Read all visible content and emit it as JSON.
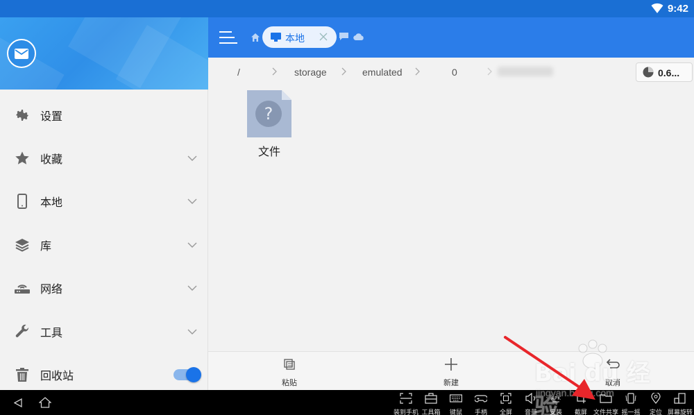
{
  "status_bar": {
    "time": "9:42"
  },
  "drawer": {
    "items": [
      {
        "label": "设置",
        "icon": "gear-icon",
        "expandable": false
      },
      {
        "label": "收藏",
        "icon": "star-icon",
        "expandable": true
      },
      {
        "label": "本地",
        "icon": "phone-icon",
        "expandable": true
      },
      {
        "label": "库",
        "icon": "layers-icon",
        "expandable": true
      },
      {
        "label": "网络",
        "icon": "router-icon",
        "expandable": true
      },
      {
        "label": "工具",
        "icon": "wrench-icon",
        "expandable": true
      },
      {
        "label": "回收站",
        "icon": "trash-icon",
        "toggle": true
      }
    ]
  },
  "toolbar": {
    "active_tab": "本地"
  },
  "path": {
    "crumbs": [
      "/",
      "storage",
      "emulated",
      "0"
    ],
    "storage_usage": "0.6..."
  },
  "files": [
    {
      "name": "文件",
      "icon": "unknown-file-icon"
    }
  ],
  "action_bar": {
    "paste": "粘贴",
    "new": "新建",
    "cancel": "取消"
  },
  "nav_tools": [
    {
      "label": "装到手机",
      "icon": "scan-icon"
    },
    {
      "label": "工具箱",
      "icon": "toolbox-icon"
    },
    {
      "label": "键鼠",
      "icon": "keyboard-icon"
    },
    {
      "label": "手柄",
      "icon": "gamepad-icon"
    },
    {
      "label": "全屏",
      "icon": "fullscreen-icon"
    },
    {
      "label": "音量",
      "icon": "volume-icon"
    },
    {
      "label": "安装",
      "icon": "apk-icon"
    },
    {
      "label": "截屏",
      "icon": "crop-icon"
    },
    {
      "label": "文件共享",
      "icon": "folder-icon"
    },
    {
      "label": "摇一摇",
      "icon": "shake-icon"
    },
    {
      "label": "定位",
      "icon": "location-icon"
    },
    {
      "label": "屏幕旋转",
      "icon": "rotate-icon"
    }
  ],
  "watermark": {
    "brand": "Bai du 经验",
    "url": "jingyan.baidu.com"
  },
  "colors": {
    "primary": "#2b7de9",
    "status_bar": "#1a6fd4",
    "accent": "#1a73e8"
  }
}
